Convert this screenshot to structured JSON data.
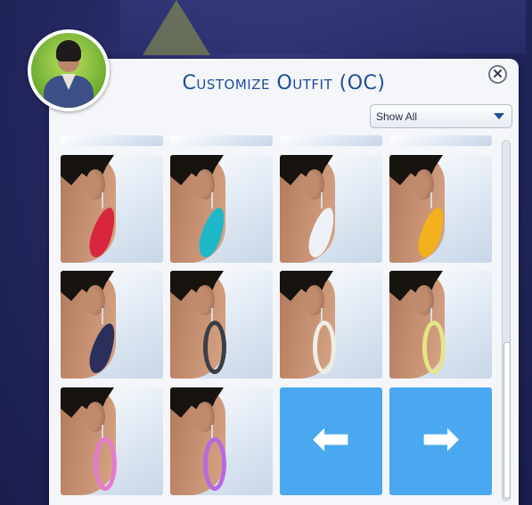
{
  "dialog": {
    "title": "Customize Outfit (OC)",
    "close_label": "✕"
  },
  "filter": {
    "selected": "Show All"
  },
  "items": [
    {
      "color": "#d7263d",
      "style": "feather"
    },
    {
      "color": "#1fb8c9",
      "style": "feather"
    },
    {
      "color": "#eef1f5",
      "style": "feather"
    },
    {
      "color": "#f3b21d",
      "style": "feather"
    },
    {
      "color": "#2c2f5c",
      "style": "feather"
    },
    {
      "color": "#3a3f45",
      "style": "hoop"
    },
    {
      "color": "#f1ede2",
      "style": "hoop"
    },
    {
      "color": "#e6e48a",
      "style": "hoop"
    },
    {
      "color": "#e57ad0",
      "style": "hoop"
    },
    {
      "color": "#b56be0",
      "style": "hoop"
    }
  ],
  "navigation": {
    "prev_icon": "arrow-left-icon",
    "next_icon": "arrow-right-icon",
    "prev_glyph": "⬅",
    "next_glyph": "➡"
  },
  "colors": {
    "accent": "#4aa8f0",
    "title": "#1d4d9c"
  }
}
